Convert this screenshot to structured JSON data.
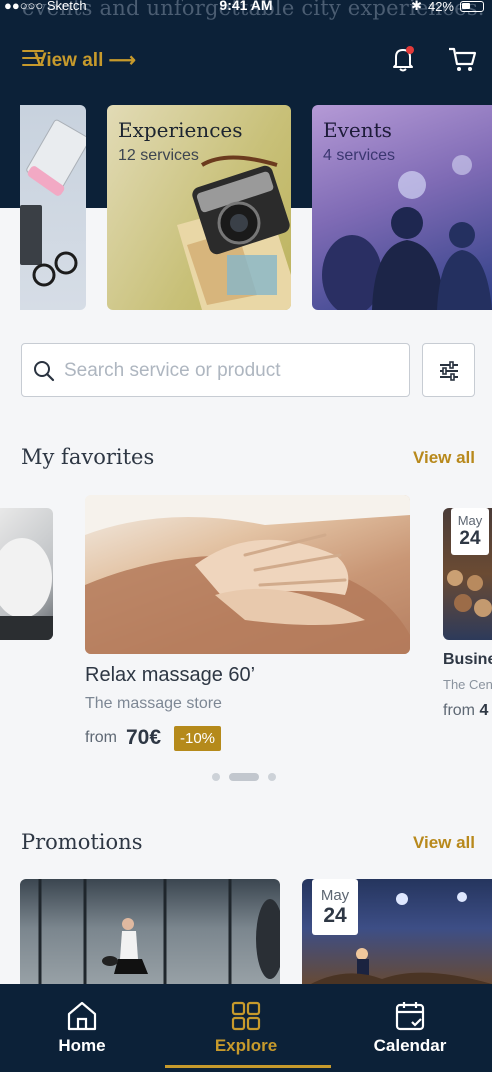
{
  "status_bar": {
    "carrier": "●●○○○ Sketch",
    "time": "9:41 AM",
    "battery": "42%"
  },
  "header": {
    "hero_text": "events and unforgettable city experiences.",
    "view_all": "View all ⟶"
  },
  "categories": [
    {
      "title": "",
      "subtitle": ""
    },
    {
      "title": "Experiences",
      "subtitle": "12 services"
    },
    {
      "title": "Events",
      "subtitle": "4 services"
    }
  ],
  "search": {
    "placeholder": "Search service or product",
    "value": ""
  },
  "favorites": {
    "title": "My favorites",
    "view_all": "View all",
    "main": {
      "title": "Relax massage 60’",
      "store": "The massage store",
      "from": "from",
      "price": "70€",
      "discount": "-10%"
    },
    "right": {
      "month": "May",
      "day": "24",
      "title": "Busine",
      "store": "The Cen",
      "from": "from",
      "price": "4"
    },
    "pager": {
      "count": 3,
      "active": 1
    }
  },
  "promotions": {
    "title": "Promotions",
    "view_all": "View all",
    "chip_month": "May",
    "chip_day": "24"
  },
  "bottom_nav": [
    {
      "label": "Home",
      "icon": "home-icon"
    },
    {
      "label": "Explore",
      "icon": "explore-grid-icon"
    },
    {
      "label": "Calendar",
      "icon": "calendar-check-icon"
    }
  ],
  "colors": {
    "navy": "#0c2138",
    "gold": "#c79a2c",
    "badge": "#b58a1b"
  }
}
